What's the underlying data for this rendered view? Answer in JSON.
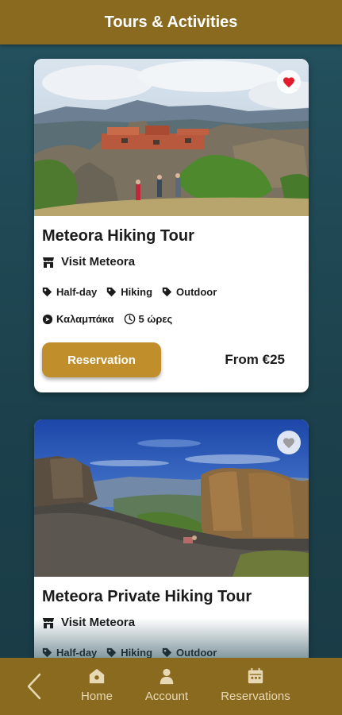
{
  "header": {
    "title": "Tours & Activities"
  },
  "cards": [
    {
      "title": "Meteora Hiking Tour",
      "provider": "Visit Meteora",
      "tags": [
        "Half-day",
        "Hiking",
        "Outdoor"
      ],
      "location": "Καλαμπάκα",
      "duration": "5 ώρες",
      "reserve_label": "Reservation",
      "price": "From €25",
      "favorite": true,
      "favorite_icon": "heart-icon",
      "favorite_color": "#e21c2c"
    },
    {
      "title": "Meteora Private Hiking Tour",
      "provider": "Visit Meteora",
      "tags": [
        "Half-day",
        "Hiking",
        "Outdoor"
      ],
      "favorite": false,
      "favorite_icon": "heart-icon",
      "favorite_color": "#9e9e9e"
    }
  ],
  "bottom_nav": {
    "back_icon": "chevron-left-icon",
    "items": [
      {
        "label": "Home",
        "icon": "home-icon"
      },
      {
        "label": "Account",
        "icon": "user-icon"
      },
      {
        "label": "Reservations",
        "icon": "calendar-icon"
      }
    ]
  },
  "colors": {
    "header_bg": "#8a6a1f",
    "page_bg": "#1e4552",
    "accent": "#c08f2c"
  }
}
